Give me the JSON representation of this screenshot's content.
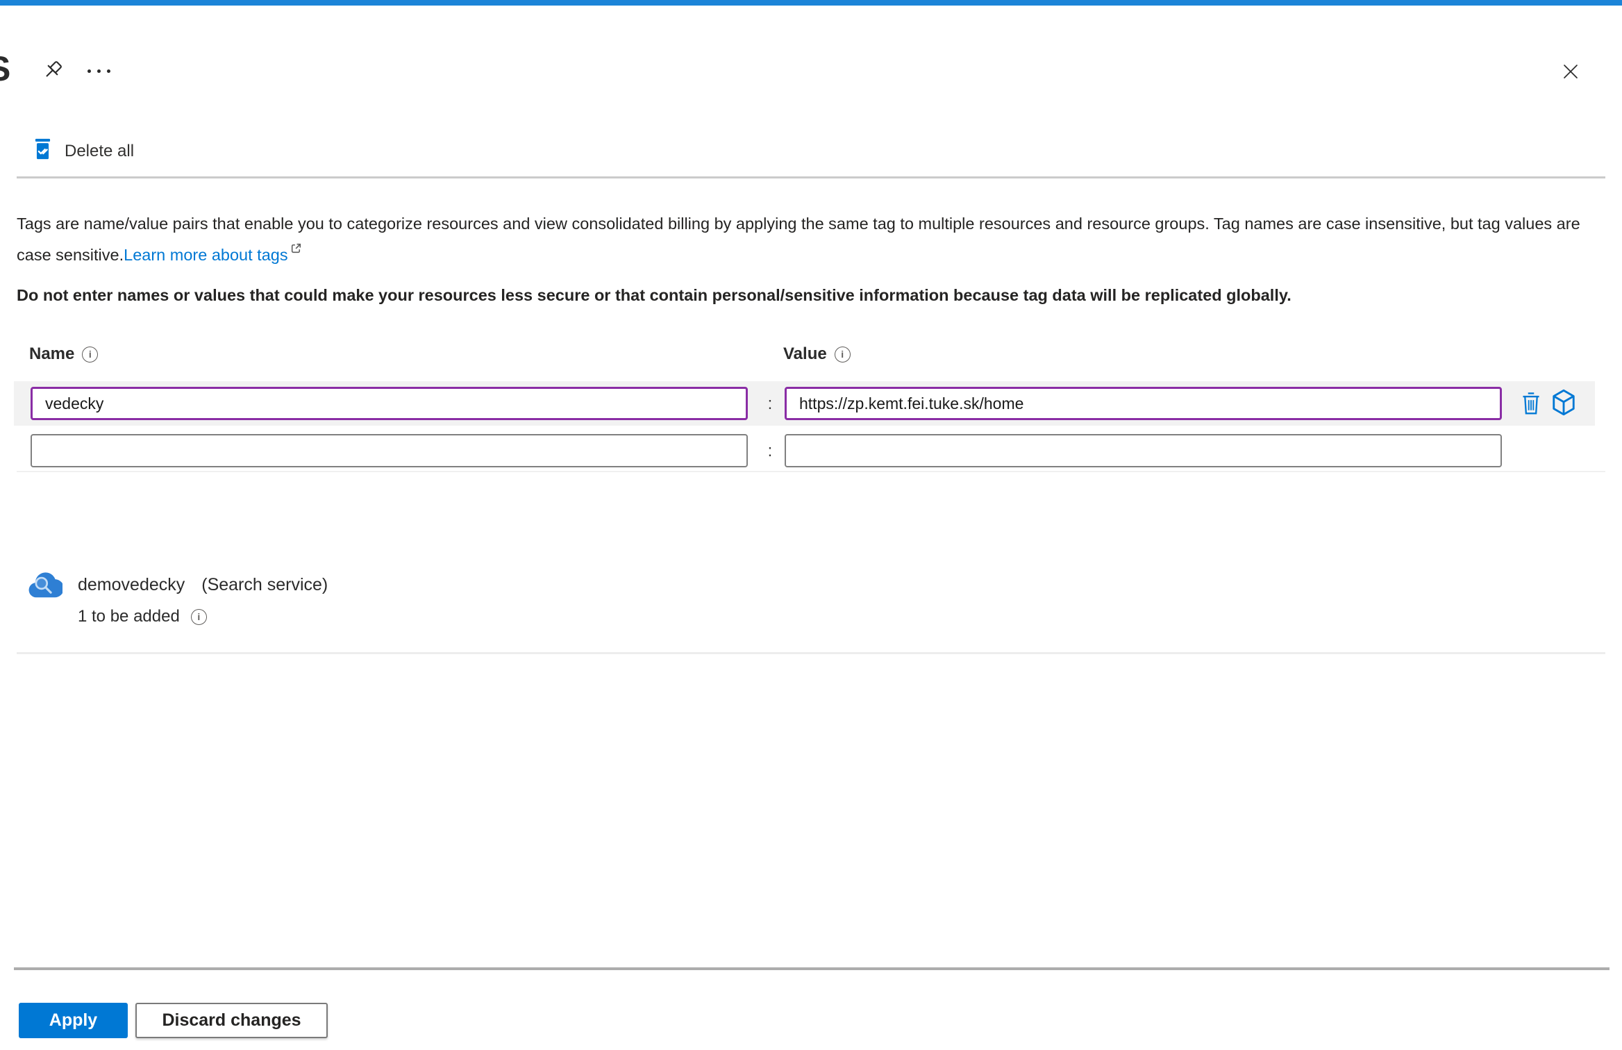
{
  "header": {
    "title_partial": "S"
  },
  "toolbar": {
    "delete_all_label": "Delete all"
  },
  "description": {
    "text": "Tags are name/value pairs that enable you to categorize resources and view consolidated billing by applying the same tag to multiple resources and resource groups. Tag names are case insensitive, but tag values are case sensitive.",
    "link_label": "Learn more about tags",
    "warning": "Do not enter names or values that could make your resources less secure or that contain personal/sensitive information because tag data will be replicated globally."
  },
  "tag_table": {
    "name_header": "Name",
    "value_header": "Value",
    "separator": ":",
    "rows": [
      {
        "name": "vedecky",
        "value": "https://zp.kemt.fei.tuke.sk/home",
        "modified": true
      },
      {
        "name": "",
        "value": "",
        "modified": false
      }
    ]
  },
  "resource": {
    "name": "demovedecky",
    "type": "(Search service)",
    "status": "1 to be added"
  },
  "footer": {
    "apply_label": "Apply",
    "discard_label": "Discard changes"
  },
  "icons": {
    "info_glyph": "i",
    "pin": "pushpin-icon",
    "more": "more-icon",
    "close": "close-icon",
    "delete_all": "trash-check-icon",
    "external_link": "external-link-icon",
    "delete_row": "trash-icon",
    "assign_row": "cube-icon",
    "resource": "search-service-cloud-icon"
  },
  "colors": {
    "accent": "#0078d4",
    "top_bar": "#1b84d8",
    "modified_border": "#8a2da5",
    "row_highlight": "#f2f2f2"
  }
}
